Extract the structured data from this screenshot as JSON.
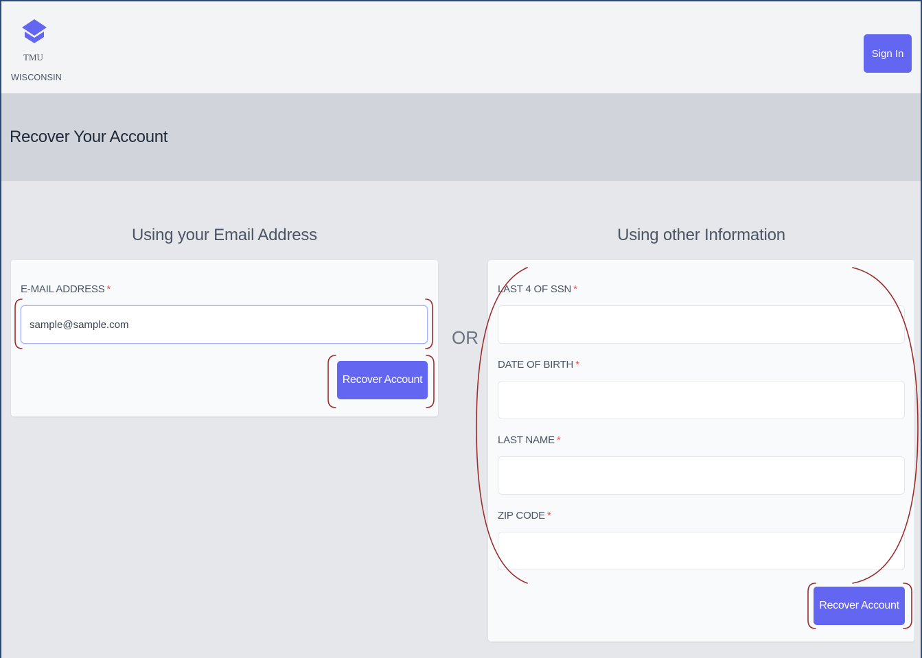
{
  "logo": {
    "name": "TMU",
    "subtitle": "WISCONSIN"
  },
  "header": {
    "signin_label": "Sign In"
  },
  "page": {
    "title": "Recover Your Account"
  },
  "email_section": {
    "heading": "Using your Email Address",
    "email_label": "E-MAIL ADDRESS",
    "email_value": "sample@sample.com",
    "button_label": "Recover Account"
  },
  "divider_text": "OR",
  "other_section": {
    "heading": "Using other Information",
    "ssn_label": "LAST 4 OF SSN",
    "ssn_value": "",
    "dob_label": "DATE OF BIRTH",
    "dob_value": "",
    "lastname_label": "LAST NAME",
    "lastname_value": "",
    "zip_label": "ZIP CODE",
    "zip_value": "",
    "button_label": "Recover Account"
  },
  "required_marker": "*",
  "colors": {
    "accent": "#6366f1",
    "required": "#e05a5a",
    "annotation": "#9b2c2c"
  }
}
